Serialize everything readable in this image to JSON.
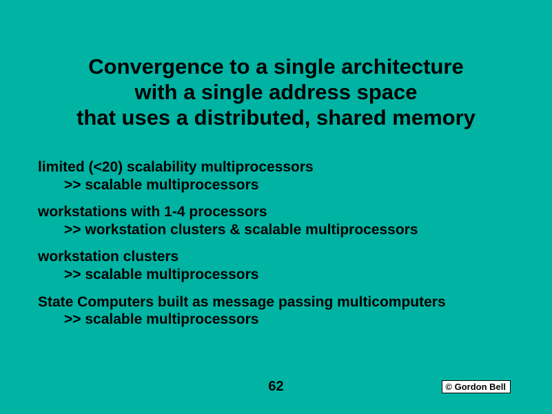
{
  "title": {
    "line1": "Convergence to a single architecture",
    "line2": "with a single address space",
    "line3": "that uses a distributed, shared memory"
  },
  "points": [
    {
      "line1": "limited (<20) scalability multiprocessors",
      "line2": ">> scalable multiprocessors"
    },
    {
      "line1": "workstations with 1-4 processors",
      "line2": ">> workstation clusters & scalable multiprocessors"
    },
    {
      "line1": "workstation clusters",
      "line2": ">> scalable multiprocessors"
    },
    {
      "line1": "State Computers built as message passing multicomputers",
      "line2": ">> scalable multiprocessors"
    }
  ],
  "page_number": "62",
  "copyright": "© Gordon Bell"
}
